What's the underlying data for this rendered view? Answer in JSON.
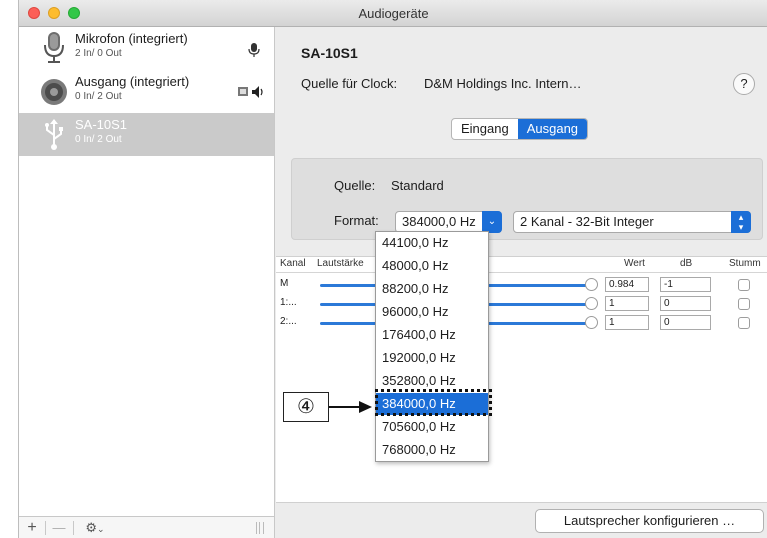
{
  "window": {
    "title": "Audiogeräte"
  },
  "sidebar": {
    "devices": [
      {
        "name": "Mikrofon (integriert)",
        "io": "2 In/ 0 Out",
        "icon": "microphone-icon",
        "badge": "microphone-icon"
      },
      {
        "name": "Ausgang (integriert)",
        "io": "0 In/ 2 Out",
        "icon": "speaker-icon",
        "badge": "speaker-output-icon"
      },
      {
        "name": "SA-10S1",
        "io": "0 In/ 2 Out",
        "icon": "usb-icon",
        "selected": true
      }
    ],
    "bottom": {
      "add": "+",
      "remove": "—",
      "actions": "gear-icon"
    }
  },
  "main": {
    "device_title": "SA-10S1",
    "clock_label": "Quelle für Clock:",
    "clock_value": "D&M Holdings Inc. Intern…",
    "help": "?",
    "tabs": [
      {
        "label": "Eingang",
        "active": false
      },
      {
        "label": "Ausgang",
        "active": true
      }
    ],
    "source_label": "Quelle:",
    "source_value": "Standard",
    "format_label": "Format:",
    "format_value": "384000,0 Hz",
    "channel_format": "2 Kanal - 32-Bit Integer",
    "table": {
      "headers": {
        "channel": "Kanal",
        "volume": "Lautstärke",
        "value": "Wert",
        "db": "dB",
        "mute": "Stumm"
      },
      "rows": [
        {
          "channel": "M",
          "value": "0.984",
          "db": "-1"
        },
        {
          "channel": "1:...",
          "value": "1",
          "db": "0"
        },
        {
          "channel": "2:...",
          "value": "1",
          "db": "0"
        }
      ]
    },
    "configure_button": "Lautsprecher konfigurieren …"
  },
  "dropdown": {
    "options": [
      "44100,0 Hz",
      "48000,0 Hz",
      "88200,0 Hz",
      "96000,0 Hz",
      "176400,0 Hz",
      "192000,0 Hz",
      "352800,0 Hz",
      "384000,0 Hz",
      "705600,0 Hz",
      "768000,0 Hz"
    ],
    "selected_index": 7
  },
  "annotation": {
    "step": "④"
  },
  "colors": {
    "accent": "#1b6ed7",
    "selection_gray": "#cacaca"
  }
}
